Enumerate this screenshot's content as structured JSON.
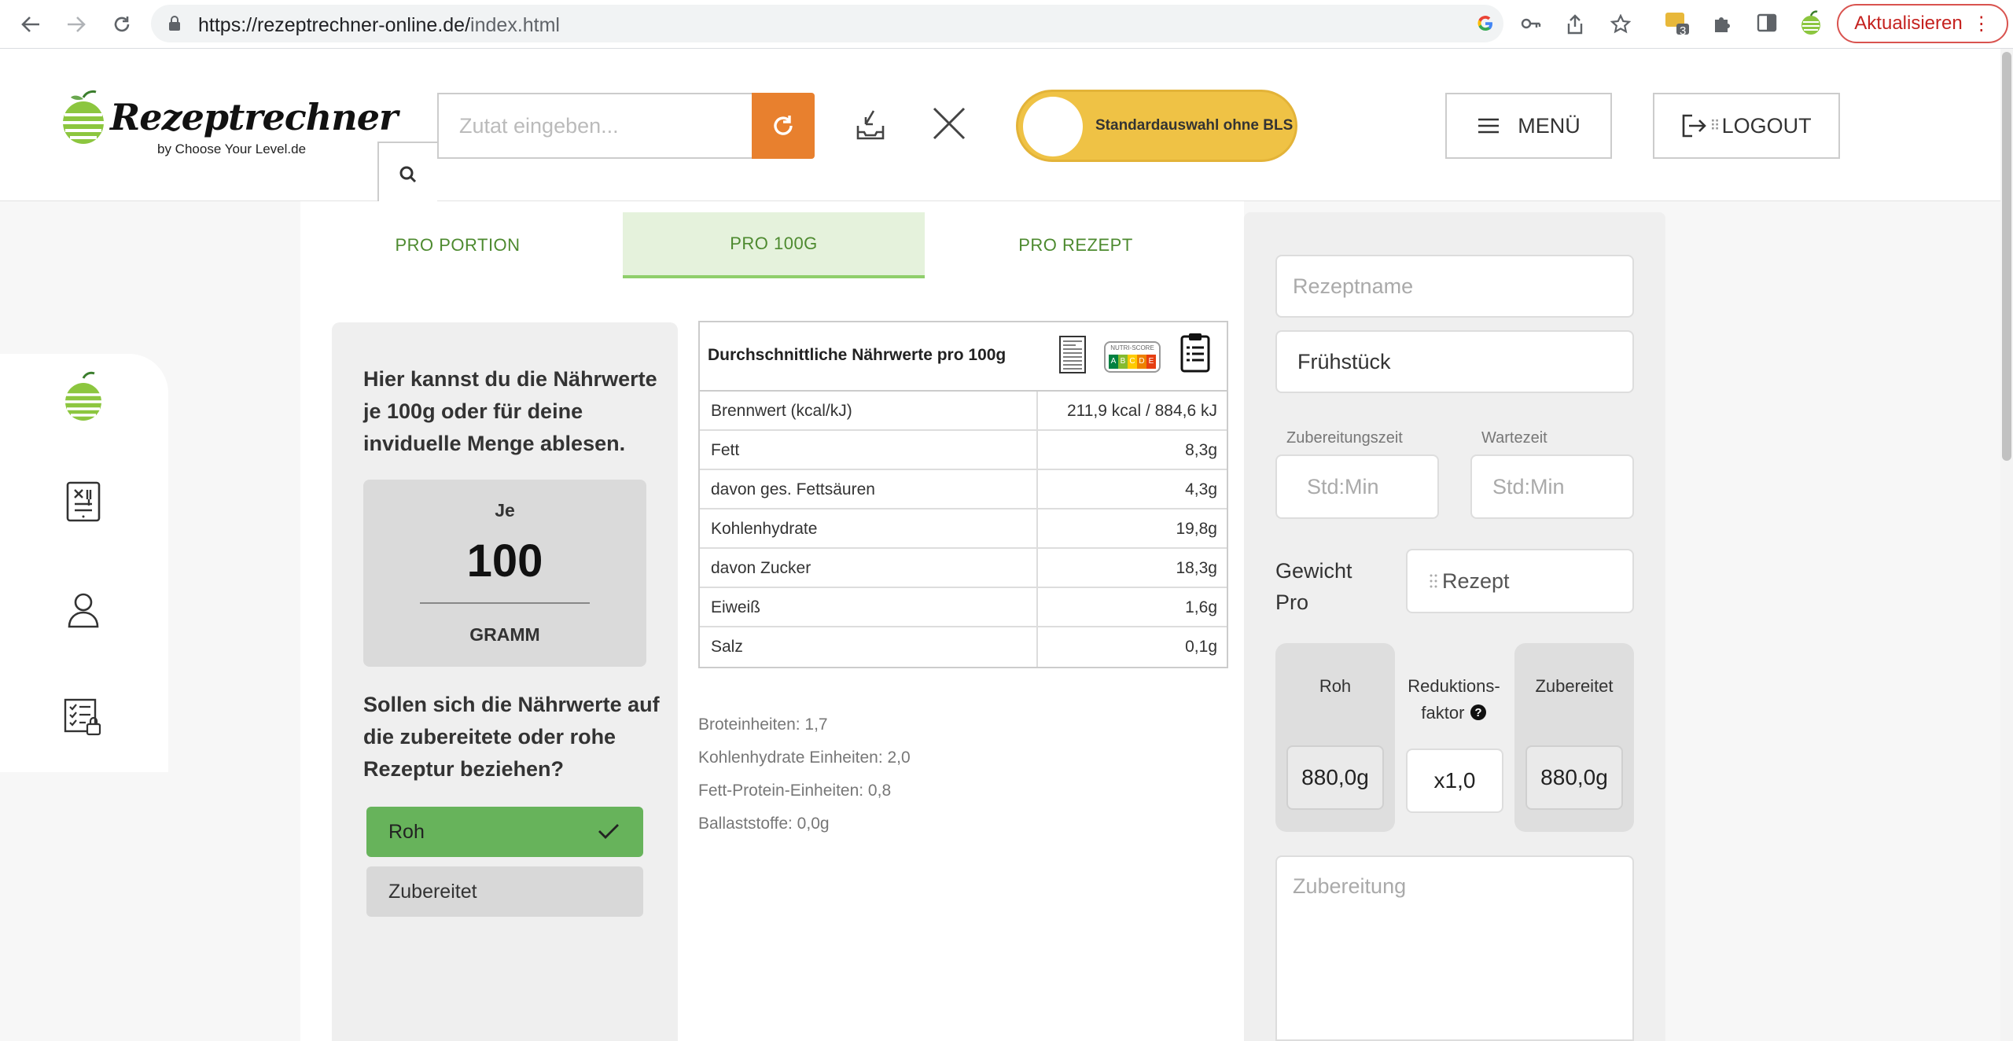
{
  "browser": {
    "url_host": "https://rezeptrechner-online.de/",
    "url_path": "index.html",
    "extension_badge": "3",
    "update_label": "Aktualisieren"
  },
  "header": {
    "logo_script": "Rezeptrechner",
    "logo_by": "by Choose Your Level.de",
    "search_placeholder": "Zutat eingeben...",
    "toggle_label": "Standardauswahl ohne BLS",
    "menu_label": "MENÜ",
    "logout_label": "LOGOUT"
  },
  "tabs": [
    {
      "label": "PRO PORTION"
    },
    {
      "label": "PRO 100G"
    },
    {
      "label": "PRO REZEPT"
    }
  ],
  "info": {
    "intro": "Hier kannst du die Nährwerte je 100g oder für deine inviduelle Menge ablesen.",
    "per_label": "Je",
    "amount": "100",
    "unit": "GRAMM",
    "question": "Sollen sich die Nährwerte auf die zubereitete oder rohe Rezeptur beziehen?",
    "option_raw": "Roh",
    "option_prepared": "Zubereitet"
  },
  "nutrition": {
    "title": "Durchschnittliche Nährwerte pro 100g",
    "nutriscore_label": "NUTRI-SCORE",
    "nutriscore_letters": [
      "A",
      "B",
      "C",
      "D",
      "E"
    ],
    "rows": [
      {
        "name": "Brennwert (kcal/kJ)",
        "value": "211,9 kcal / 884,6 kJ"
      },
      {
        "name": "Fett",
        "value": "8,3g"
      },
      {
        "name": "davon ges. Fettsäuren",
        "value": "4,3g"
      },
      {
        "name": "Kohlenhydrate",
        "value": "19,8g"
      },
      {
        "name": "davon Zucker",
        "value": "18,3g"
      },
      {
        "name": "Eiweiß",
        "value": "1,6g"
      },
      {
        "name": "Salz",
        "value": "0,1g"
      }
    ],
    "extras": [
      "Broteinheiten: 1,7",
      "Kohlenhydrate Einheiten: 2,0",
      "Fett-Protein-Einheiten: 0,8",
      "Ballaststoffe: 0,0g"
    ]
  },
  "recipe": {
    "name_placeholder": "Rezeptname",
    "category_value": "Frühstück",
    "prep_time_label": "Zubereitungszeit",
    "wait_time_label": "Wartezeit",
    "time_placeholder": "Std:Min",
    "weight_label_1": "Gewicht",
    "weight_label_2": "Pro",
    "weight_value": "Rezept",
    "raw_label": "Roh",
    "raw_value": "880,0g",
    "reduction_label_1": "Reduktions-",
    "reduction_label_2": "faktor",
    "reduction_value": "x1,0",
    "prepared_label": "Zubereitet",
    "prepared_value": "880,0g",
    "prep_placeholder": "Zubereitung"
  },
  "colors": {
    "brand_green": "#67b35b",
    "accent_orange": "#e8802e",
    "toggle_yellow": "#efc245"
  }
}
